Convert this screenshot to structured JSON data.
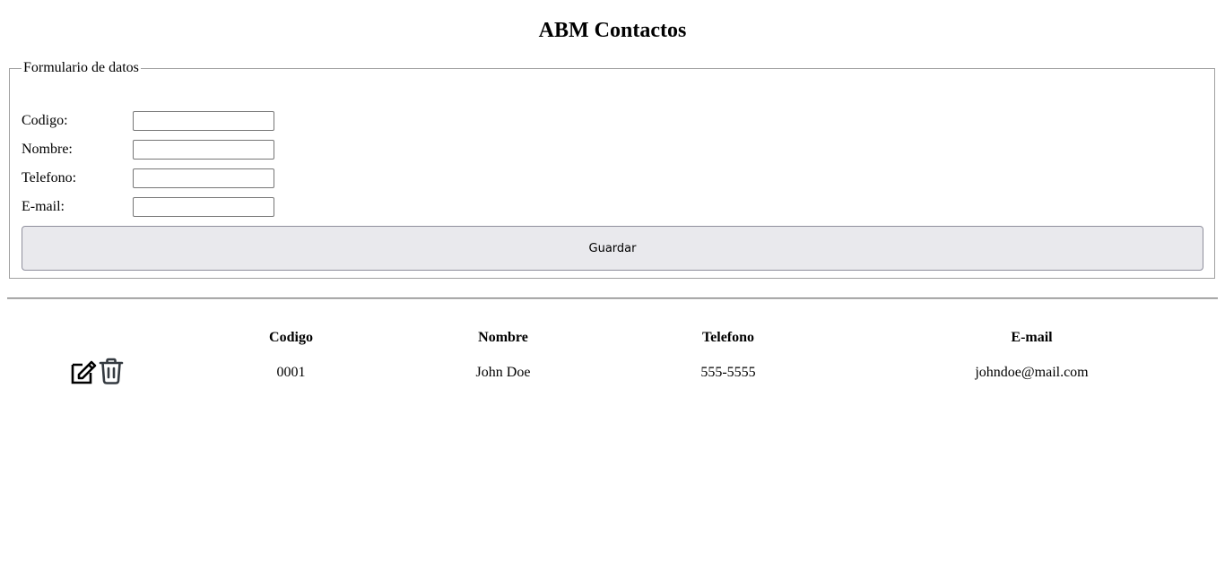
{
  "header": {
    "title": "ABM Contactos"
  },
  "form": {
    "legend": "Formulario de datos",
    "fields": [
      {
        "label": "Codigo:",
        "value": "",
        "placeholder": ""
      },
      {
        "label": "Nombre:",
        "value": "",
        "placeholder": ""
      },
      {
        "label": "Telefono:",
        "value": "",
        "placeholder": ""
      },
      {
        "label": "E-mail:",
        "value": "",
        "placeholder": ""
      }
    ],
    "save_label": "Guardar"
  },
  "table": {
    "columns": [
      "",
      "Codigo",
      "Nombre",
      "Telefono",
      "E-mail"
    ],
    "rows": [
      {
        "codigo": "0001",
        "nombre": "John Doe",
        "telefono": "555-5555",
        "email": "johndoe@mail.com",
        "edit_icon": "edit-icon",
        "delete_icon": "trash-icon"
      }
    ]
  },
  "colors": {
    "button_bg": "#e9e9ed",
    "icon_edit": "#000000",
    "icon_delete": "#343a40"
  }
}
